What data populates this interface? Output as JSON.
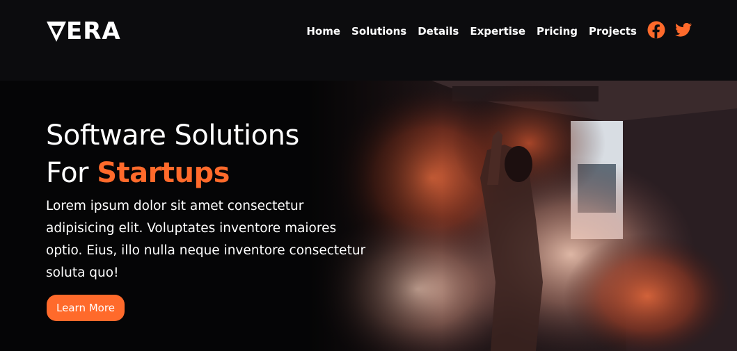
{
  "brand": {
    "logo_first": "V",
    "logo_rest": "ERA"
  },
  "nav": {
    "links": [
      "Home",
      "Solutions",
      "Details",
      "Expertise",
      "Pricing",
      "Projects"
    ],
    "social": [
      {
        "icon": "facebook-icon",
        "color": "#ff6a2b"
      },
      {
        "icon": "twitter-icon",
        "color": "#ff6a2b"
      }
    ]
  },
  "hero": {
    "title_line1": "Software Solutions",
    "title_line2_prefix": "For ",
    "title_line2_accent": "Startups",
    "body": "Lorem ipsum dolor sit amet consectetur adipisicing elit. Voluptates inventore maiores optio. Eius, illo nulla neque inventore consectetur soluta quo!",
    "cta_label": "Learn More"
  },
  "colors": {
    "accent": "#ff6a2b",
    "navbar_bg": "#0c0c0e",
    "hero_bg": "#050506"
  }
}
